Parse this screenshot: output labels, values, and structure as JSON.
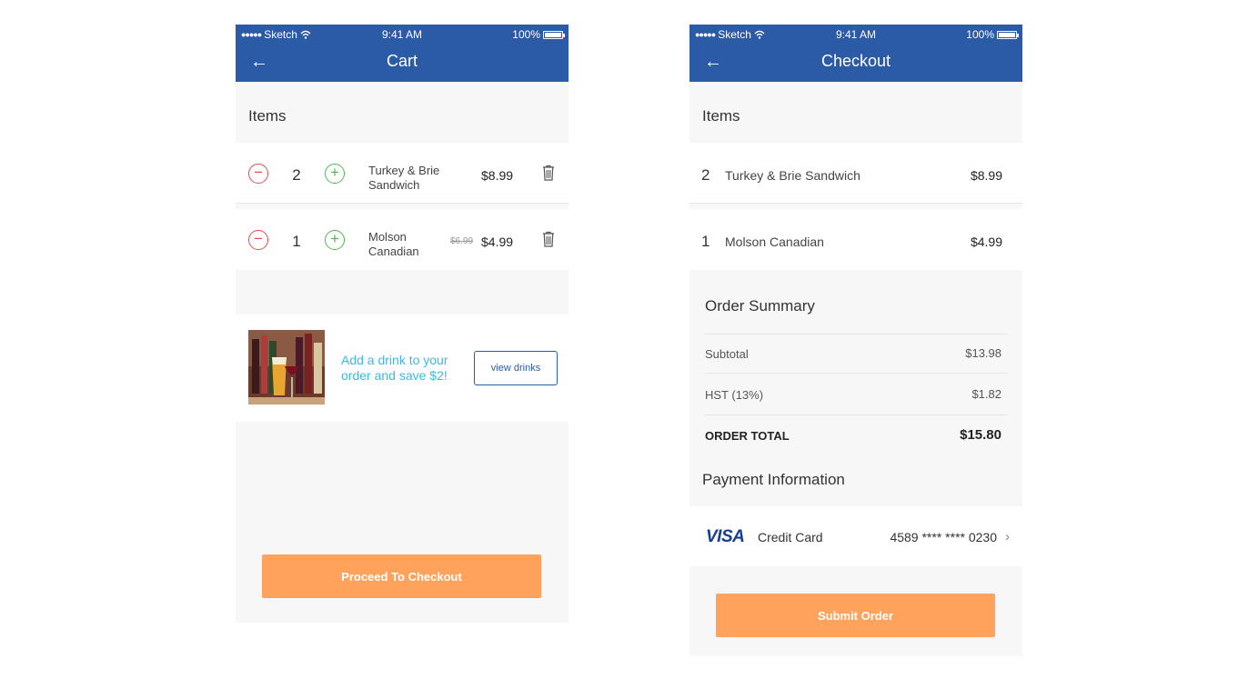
{
  "status_bar": {
    "signal": "●●●●●",
    "carrier": "Sketch",
    "wifi_icon": "wifi-icon",
    "time": "9:41 AM",
    "battery": "100%"
  },
  "cart": {
    "title": "Cart",
    "items_heading": "Items",
    "items": [
      {
        "qty": "2",
        "name": "Turkey & Brie Sandwich",
        "old_price": "",
        "price": "$8.99"
      },
      {
        "qty": "1",
        "name": "Molson Canadian",
        "old_price": "$6.99",
        "price": "$4.99"
      }
    ],
    "promo": {
      "text": "Add a drink to your order and save $2!",
      "button": "view drinks"
    },
    "checkout_button": "Proceed To Checkout"
  },
  "checkout": {
    "title": "Checkout",
    "items_heading": "Items",
    "items": [
      {
        "qty": "2",
        "name": "Turkey & Brie Sandwich",
        "price": "$8.99"
      },
      {
        "qty": "1",
        "name": "Molson Canadian",
        "price": "$4.99"
      }
    ],
    "summary": {
      "heading": "Order Summary",
      "subtotal_label": "Subtotal",
      "subtotal_value": "$13.98",
      "tax_label": "HST (13%)",
      "tax_value": "$1.82",
      "total_label": "ORDER TOTAL",
      "total_value": "$15.80"
    },
    "payment": {
      "heading": "Payment Information",
      "brand": "VISA",
      "card_type": "Credit Card",
      "card_number": "4589 **** **** 0230"
    },
    "submit_button": "Submit Order"
  },
  "colors": {
    "header_blue": "#2b5aa6",
    "accent_orange": "#ffa25c",
    "minus_red": "#e84a4a",
    "plus_green": "#4cbb4c",
    "promo_cyan": "#3bb8e4",
    "visa_blue": "#1a3d8f"
  }
}
